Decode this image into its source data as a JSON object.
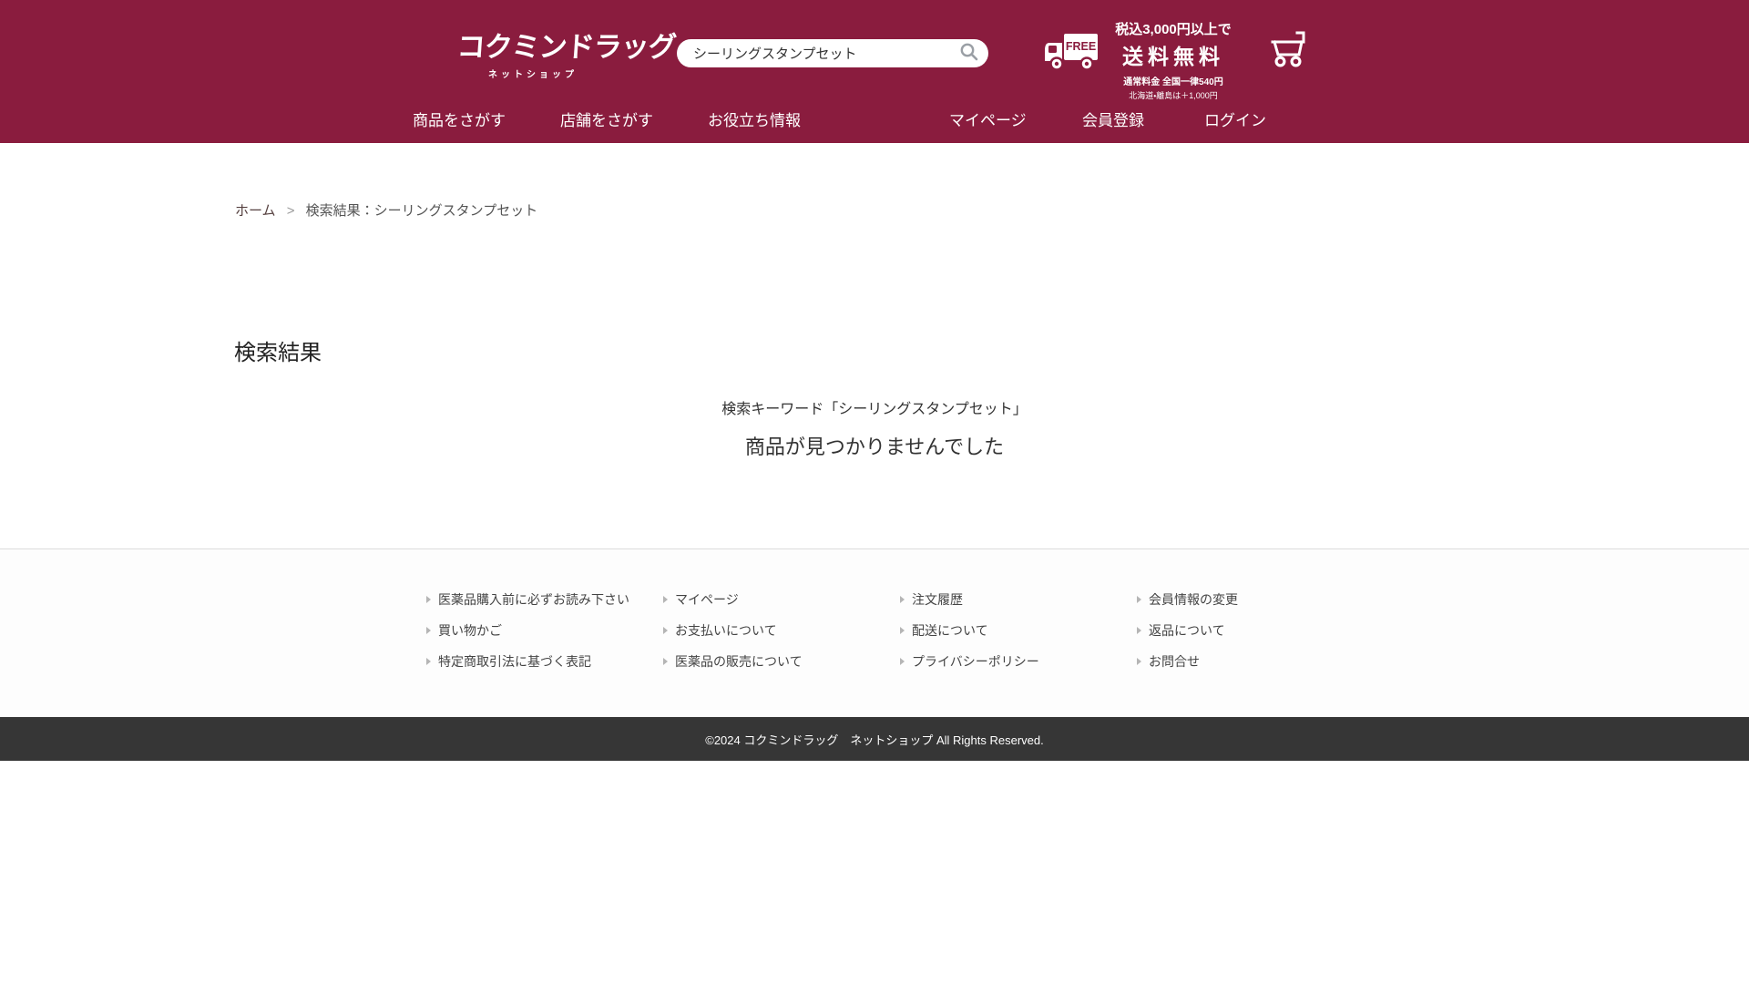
{
  "theme": {
    "maroon": "#8a1c3e",
    "copyright_bar_bg": "#363636",
    "footer_bg": "#fdfdfd"
  },
  "icons": {
    "search": "magnifier-icon",
    "shipping": "delivery-truck-icon",
    "cart": "shopping-cart-icon",
    "footer_bullet": "triangle-right-icon"
  },
  "header": {
    "logo": {
      "title": "コクミンドラッグ",
      "subtitle": "ネットショップ"
    },
    "search": {
      "value": "シーリングスタンプセット",
      "placeholder": ""
    },
    "shipping": {
      "free_label": "FREE",
      "line1": "税込3,000円以上で",
      "line2": "送料無料",
      "line3": "通常料金 全国一律540円",
      "line4": "北海道・離島は＋1,000円"
    },
    "nav": {
      "items": [
        "商品をさがす",
        "店舗をさがす",
        "お役立ち情報",
        "マイページ",
        "会員登録",
        "ログイン"
      ]
    }
  },
  "breadcrumb": {
    "home": "ホーム",
    "separator": ">",
    "current": "検索結果：シーリングスタンプセット"
  },
  "main": {
    "title": "検索結果",
    "keyword_line": "検索キーワード「シーリングスタンプセット」",
    "no_result_line": "商品が見つかりませんでした"
  },
  "footer": {
    "columns": [
      [
        "医薬品購入前に必ずお読み下さい",
        "買い物かご",
        "特定商取引法に基づく表記"
      ],
      [
        "マイページ",
        "お支払いについて",
        "医薬品の販売について"
      ],
      [
        "注文履歴",
        "配送について",
        "プライバシーポリシー"
      ],
      [
        "会員情報の変更",
        "返品について",
        "お問合せ"
      ]
    ],
    "copyright": "©2024 コクミンドラッグ　ネットショップ All Rights Reserved."
  }
}
